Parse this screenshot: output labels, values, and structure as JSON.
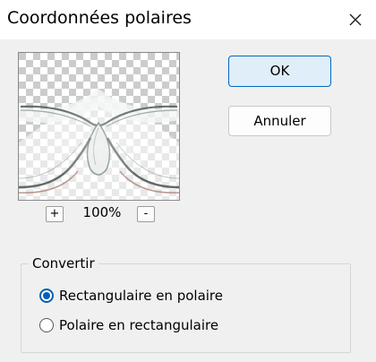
{
  "window": {
    "title": "Coordonnées polaires",
    "close_icon": "close-icon"
  },
  "preview": {
    "zoom_in_label": "+",
    "zoom_out_label": "-",
    "zoom_level": "100%"
  },
  "buttons": {
    "ok_label": "OK",
    "cancel_label": "Annuler"
  },
  "convert": {
    "legend": "Convertir",
    "options": [
      {
        "label": "Rectangulaire en polaire",
        "selected": true
      },
      {
        "label": "Polaire en rectangulaire",
        "selected": false
      }
    ]
  },
  "colors": {
    "accent": "#005fb8",
    "ok_background": "#e0eef9",
    "window_background": "#f0f0f0"
  }
}
